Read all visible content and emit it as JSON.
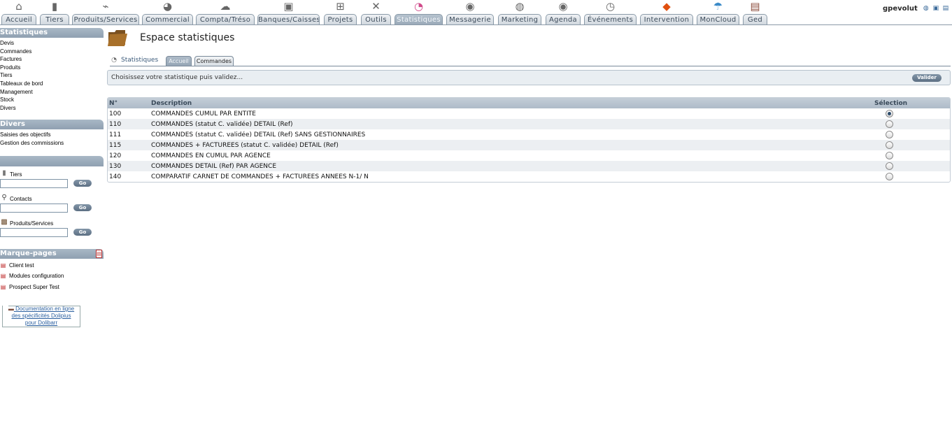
{
  "topmenu": {
    "tabs": [
      {
        "label": "Accueil",
        "icon": "home-icon",
        "glyph": "⌂"
      },
      {
        "label": "Tiers",
        "icon": "tiers-icon",
        "glyph": "▮"
      },
      {
        "label": "Produits/Services",
        "icon": "products-icon",
        "glyph": "⌁"
      },
      {
        "label": "Commercial",
        "icon": "commercial-icon",
        "glyph": "◕"
      },
      {
        "label": "Compta/Tréso",
        "icon": "compta-icon",
        "glyph": "☁"
      },
      {
        "label": "Banques/Caisses",
        "icon": "bank-icon",
        "glyph": "▣"
      },
      {
        "label": "Projets",
        "icon": "projects-icon",
        "glyph": "⊞"
      },
      {
        "label": "Outils",
        "icon": "tools-icon",
        "glyph": "✕"
      },
      {
        "label": "Statistiques",
        "icon": "statistics-icon",
        "glyph": "◔"
      },
      {
        "label": "Messagerie",
        "icon": "mail-icon",
        "glyph": "◉"
      },
      {
        "label": "Marketing",
        "icon": "marketing-icon",
        "glyph": "◍"
      },
      {
        "label": "Agenda",
        "icon": "agenda-icon",
        "glyph": "◉"
      },
      {
        "label": "Événements",
        "icon": "events-icon",
        "glyph": "◷"
      },
      {
        "label": "Intervention",
        "icon": "intervention-icon",
        "glyph": "◆"
      },
      {
        "label": "MonCloud",
        "icon": "cloud-icon",
        "glyph": "☂"
      },
      {
        "label": "Ged",
        "icon": "ged-icon",
        "glyph": "▤"
      }
    ],
    "active": "Statistiques"
  },
  "user": {
    "name": "gpevolut"
  },
  "sidebar": {
    "statistiques": {
      "title": "Statistiques",
      "items": [
        "Devis",
        "Commandes",
        "Factures",
        "Produits",
        "Tiers",
        "Tableaux de bord",
        "Management",
        "Stock",
        "Divers"
      ]
    },
    "divers": {
      "title": "Divers",
      "items": [
        "Saisies des objectifs",
        "Gestion des commissions"
      ]
    },
    "search": {
      "title": "",
      "tiers_label": "Tiers",
      "contacts_label": "Contacts",
      "products_label": "Produits/Services",
      "go_label": "Go"
    },
    "bookmarks": {
      "title": "Marque-pages",
      "items": [
        "Client test",
        "Modules configuration",
        "Prospect Super Test"
      ]
    },
    "doc_link": {
      "line1": "Documentation en ligne",
      "line2": "des spécificités Dolipius",
      "line3": "pour Dolibarr"
    }
  },
  "main": {
    "title": "Espace statistiques",
    "subtabs": {
      "section_label": "Statistiques",
      "tabs": [
        "Accueil",
        "Commandes"
      ],
      "active": "Accueil"
    },
    "choose_text": "Choisissez votre statistique puis validez...",
    "valider_label": "Valider",
    "table": {
      "headers": {
        "num": "N°",
        "desc": "Description",
        "sel": "Sélection"
      },
      "rows": [
        {
          "num": "100",
          "desc": "COMMANDES CUMUL PAR ENTITE",
          "selected": true
        },
        {
          "num": "110",
          "desc": "COMMANDES (statut C. validée) DETAIL (Ref)",
          "selected": false
        },
        {
          "num": "111",
          "desc": "COMMANDES (statut C. validée) DETAIL (Ref) SANS GESTIONNAIRES",
          "selected": false
        },
        {
          "num": "115",
          "desc": "COMMANDES + FACTUREES (statut C. validée) DETAIL (Ref)",
          "selected": false
        },
        {
          "num": "120",
          "desc": "COMMANDES EN CUMUL PAR AGENCE",
          "selected": false
        },
        {
          "num": "130",
          "desc": "COMMANDES DETAIL (Ref) PAR AGENCE",
          "selected": false
        },
        {
          "num": "140",
          "desc": "COMPARATIF CARNET DE COMMANDES + FACTUREES ANNEES N-1/ N",
          "selected": false
        }
      ]
    }
  }
}
